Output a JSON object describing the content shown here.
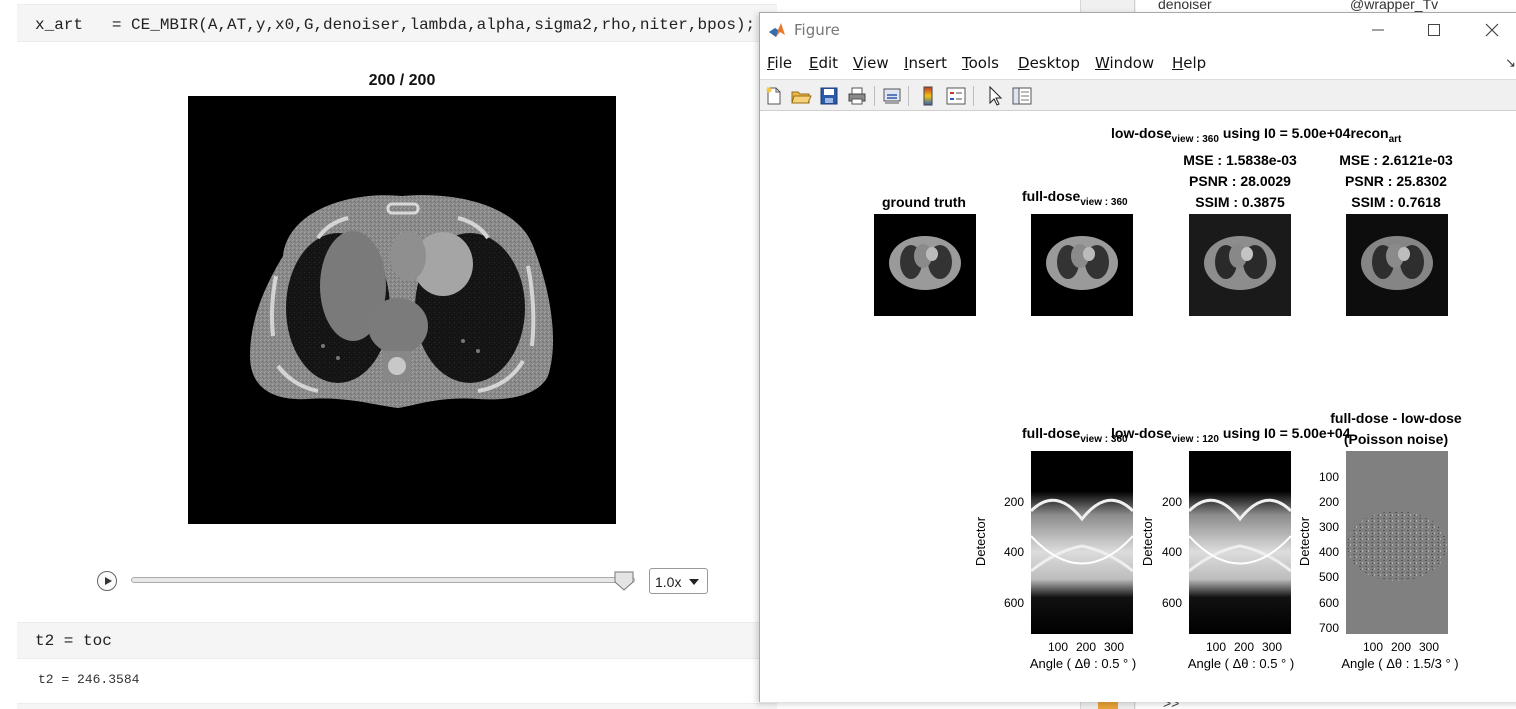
{
  "script": {
    "cell1_code": "x_art   = CE_MBIR(A,AT,y,x0,G,denoiser,lambda,alpha,sigma2,rho,niter,bpos);",
    "figure_title": "200 / 200",
    "player": {
      "speed": "1.0x",
      "progress": 1.0
    },
    "cell2_code": "t2 = toc",
    "output_line": "t2 = 246.3584"
  },
  "workspace": {
    "top_name": "denoiser",
    "top_value": "@wrapper_Tv",
    "prompt": ">>"
  },
  "figure_window": {
    "title": "Figure",
    "menu": [
      {
        "label": "File",
        "mnemonic": "F",
        "rest": "ile"
      },
      {
        "label": "Edit",
        "mnemonic": "E",
        "rest": "dit"
      },
      {
        "label": "View",
        "mnemonic": "V",
        "rest": "iew"
      },
      {
        "label": "Insert",
        "mnemonic": "I",
        "rest": "nsert"
      },
      {
        "label": "Tools",
        "mnemonic": "T",
        "rest": "ools"
      },
      {
        "label": "Desktop",
        "mnemonic": "D",
        "rest": "esktop"
      },
      {
        "label": "Window",
        "mnemonic": "W",
        "rest": "indow"
      },
      {
        "label": "Help",
        "mnemonic": "H",
        "rest": "elp"
      }
    ],
    "toolbar_icons": [
      "new-figure-icon",
      "open-icon",
      "save-icon",
      "print-icon",
      "link-icon",
      "colorbar-icon",
      "legend-icon",
      "pointer-icon",
      "property-inspector-icon"
    ]
  },
  "figure": {
    "top_row": {
      "ground_truth": "ground truth",
      "full_dose": {
        "text": "full-dose",
        "sub": "view : 360"
      },
      "super_title": {
        "a": "low-dose",
        "a_sub": "view : 360",
        "b": " using I0 = 5.00e+04recon",
        "b_sub": "art"
      },
      "lowdose_metrics": {
        "mse": "MSE : 1.5838e-03",
        "psnr": "PSNR : 28.0029",
        "ssim": "SSIM : 0.3875"
      },
      "recon_metrics": {
        "mse": "MSE : 2.6121e-03",
        "psnr": "PSNR : 25.8302",
        "ssim": "SSIM : 0.7618"
      }
    },
    "bottom_row": {
      "full_dose_title": {
        "text": "full-dose",
        "sub": "view : 360"
      },
      "low_dose_title": {
        "text": "low-dose",
        "sub": "view : 120",
        "rest": " using I0 = 5.00e+04"
      },
      "diff_title_1": "full-dose - low-dose",
      "diff_title_2": "(Poisson noise)",
      "ylabel": "Detector",
      "sino1_yticks": [
        "200",
        "400",
        "600"
      ],
      "sino2_yticks": [
        "200",
        "400",
        "600"
      ],
      "sino3_yticks": [
        "100",
        "200",
        "300",
        "400",
        "500",
        "600",
        "700"
      ],
      "xticks": [
        "100",
        "200",
        "300"
      ],
      "xlabel_1": "Angle ( Δθ : 0.5 ° )",
      "xlabel_2": "Angle ( Δθ : 0.5 ° )",
      "xlabel_3": "Angle ( Δθ : 1.5/3 ° )"
    }
  }
}
